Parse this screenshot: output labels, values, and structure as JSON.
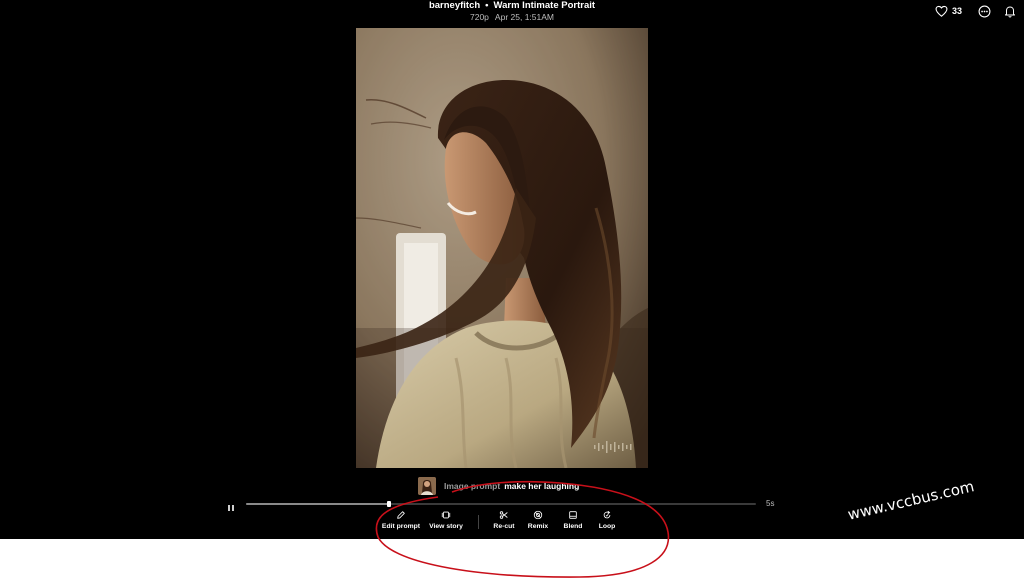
{
  "header": {
    "author": "barneyfitch",
    "separator": "•",
    "title": "Warm Intimate Portrait",
    "resolution": "720p",
    "date": "Apr 25, 1:51AM"
  },
  "actions": {
    "like_count": "33"
  },
  "prompt": {
    "label": "Image prompt",
    "text": "make her laughing"
  },
  "playback": {
    "duration": "5s",
    "progress_fraction": 0.28
  },
  "toolbar": [
    {
      "name": "edit-prompt-button",
      "icon": "pencil-icon",
      "label": "Edit prompt"
    },
    {
      "name": "view-story-button",
      "icon": "story-icon",
      "label": "View story"
    },
    {
      "name": "re-cut-button",
      "icon": "scissors-icon",
      "label": "Re-cut"
    },
    {
      "name": "remix-button",
      "icon": "remix-icon",
      "label": "Remix"
    },
    {
      "name": "blend-button",
      "icon": "blend-icon",
      "label": "Blend"
    },
    {
      "name": "loop-button",
      "icon": "loop-icon",
      "label": "Loop"
    }
  ],
  "watermark": "www.vccbus.com",
  "colors": {
    "background": "#000000",
    "text": "#ffffff",
    "muted_text": "#bdbdbd",
    "annotation": "#c8101a"
  }
}
